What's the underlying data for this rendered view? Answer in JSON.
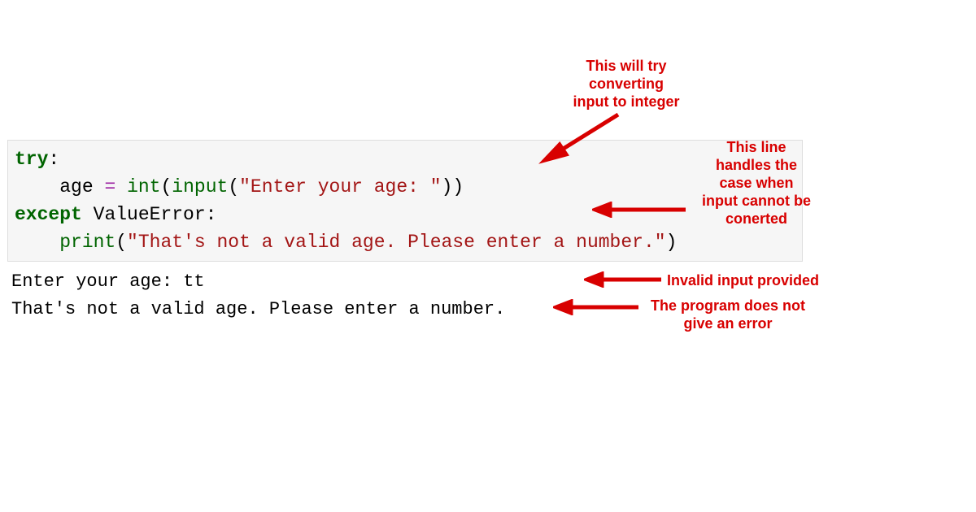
{
  "code": {
    "line1_try": "try",
    "line1_colon": ":",
    "indent": "    ",
    "line2_var": "age",
    "line2_eq": " = ",
    "line2_int": "int",
    "line2_open": "(",
    "line2_input": "input",
    "line2_popen": "(",
    "line2_str": "\"Enter your age: \"",
    "line2_close": "))",
    "line3_except": "except",
    "line3_sp": " ",
    "line3_err": "ValueError",
    "line3_colon": ":",
    "line4_print": "print",
    "line4_open": "(",
    "line4_str": "\"That's not a valid age. Please enter a number.\"",
    "line4_close": ")"
  },
  "output": {
    "line1": "Enter your age: tt",
    "line2": "That's not a valid age. Please enter a number."
  },
  "annotations": {
    "a1": "This will try\nconverting\ninput to integer",
    "a2": "This line\nhandles the\ncase when\ninput cannot be\nconerted",
    "a3": "Invalid input provided",
    "a4": "The program does not\ngive an error"
  },
  "colors": {
    "annotation": "#d80000",
    "code_bg": "#f6f6f6",
    "keyword": "#006400",
    "operator": "#9b1fa0",
    "string": "#a31515"
  }
}
